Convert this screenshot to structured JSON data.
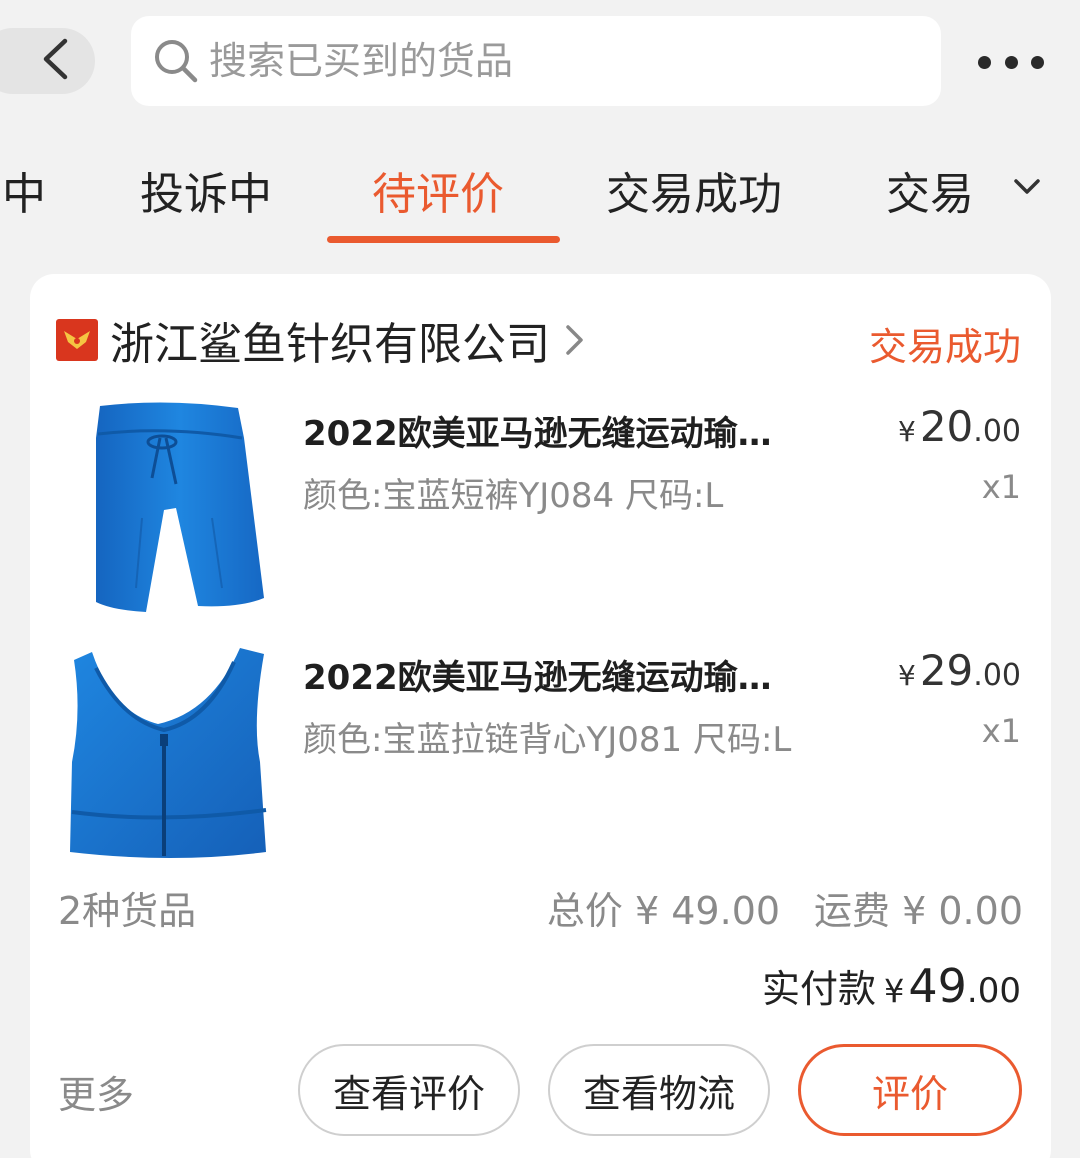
{
  "header": {
    "search_placeholder": "搜索已买到的货品"
  },
  "tabs": [
    {
      "label": "中"
    },
    {
      "label": "投诉中"
    },
    {
      "label": "待评价",
      "active": true
    },
    {
      "label": "交易成功"
    },
    {
      "label": "交易"
    }
  ],
  "order": {
    "shop_name": "浙江鲨鱼针织有限公司",
    "status": "交易成功",
    "items": [
      {
        "title": "2022欧美亚马逊无缝运动瑜…",
        "spec": "颜色:宝蓝短裤YJ084 尺码:L",
        "price_int": "20",
        "price_dec": ".00",
        "qty": "x1",
        "image": "blue-sport-shorts"
      },
      {
        "title": "2022欧美亚马逊无缝运动瑜…",
        "spec": "颜色:宝蓝拉链背心YJ081 尺码:L",
        "price_int": "29",
        "price_dec": ".00",
        "qty": "x1",
        "image": "blue-zip-sports-bra"
      }
    ],
    "item_count": "2种货品",
    "total": "总价 ¥ 49.00",
    "shipping": "运费 ¥ 0.00",
    "paid_label": "实付款",
    "paid_int": "49",
    "paid_dec": ".00",
    "currency": "¥"
  },
  "actions": {
    "more": "更多",
    "view_review": "查看评价",
    "view_logistics": "查看物流",
    "review": "评价"
  },
  "colors": {
    "accent": "#ea5a2f",
    "product_blue": "#1f7fd6"
  }
}
